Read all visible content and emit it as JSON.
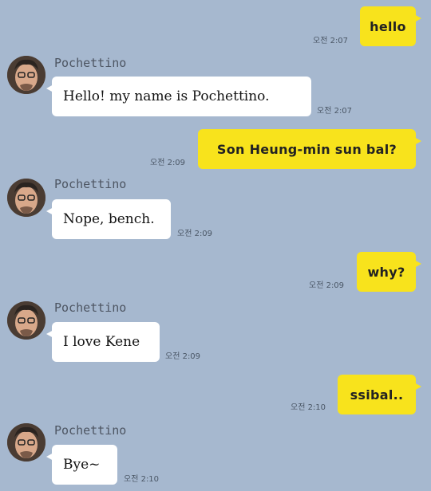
{
  "colors": {
    "background": "#a6b8cf",
    "outgoing_bubble": "#f8e31c",
    "incoming_bubble": "#ffffff"
  },
  "messages": [
    {
      "direction": "out",
      "text": "hello",
      "time": "오전 2:07"
    },
    {
      "direction": "in",
      "sender": "Pochettino",
      "text": "Hello! my name is Pochettino.",
      "time": "오전 2:07"
    },
    {
      "direction": "out",
      "text": "Son Heung-min sun bal?",
      "time": "오전 2:09"
    },
    {
      "direction": "in",
      "sender": "Pochettino",
      "text": "Nope, bench.",
      "time": "오전 2:09"
    },
    {
      "direction": "out",
      "text": "why?",
      "time": "오전 2:09"
    },
    {
      "direction": "in",
      "sender": "Pochettino",
      "text": "I love Kene",
      "time": "오전 2:09"
    },
    {
      "direction": "out",
      "text": "ssibal..",
      "time": "오전 2:10"
    },
    {
      "direction": "in",
      "sender": "Pochettino",
      "text": "Bye~",
      "time": "오전 2:10"
    }
  ]
}
